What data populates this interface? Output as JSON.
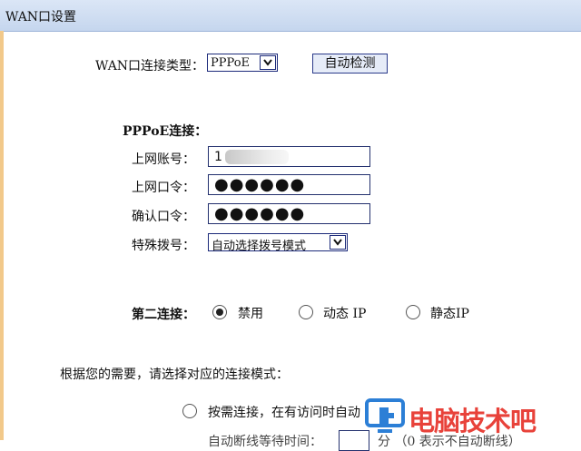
{
  "window": {
    "title": "WAN口设置"
  },
  "wan_type": {
    "label": "WAN口连接类型：",
    "selected": "PPPoE",
    "detect_button": "自动检测"
  },
  "pppoe": {
    "section_label": "PPPoE连接：",
    "account_label": "上网账号：",
    "account_value_visible": "1",
    "password_label": "上网口令：",
    "password_mask": "●●●●●●",
    "confirm_label": "确认口令：",
    "confirm_mask": "●●●●●●",
    "dial_label": "特殊拨号：",
    "dial_selected": "自动选择拨号模式"
  },
  "second_connection": {
    "label": "第二连接：",
    "options": [
      {
        "label": "禁用",
        "selected": true
      },
      {
        "label": "动态 IP",
        "selected": false
      },
      {
        "label": "静态IP",
        "selected": false
      }
    ]
  },
  "mode": {
    "intro": "根据您的需要，请选择对应的连接模式：",
    "on_demand": "按需连接，在有访问时自动",
    "partial_line": "自动断线等待时间：",
    "partial_unit": "分 （0 表示不自动断线）"
  },
  "watermark": {
    "text": "电脑技术吧"
  },
  "colors": {
    "title_bg": "#c5d6ee",
    "border": "#1c2a7a",
    "watermark": "#e8423a"
  }
}
